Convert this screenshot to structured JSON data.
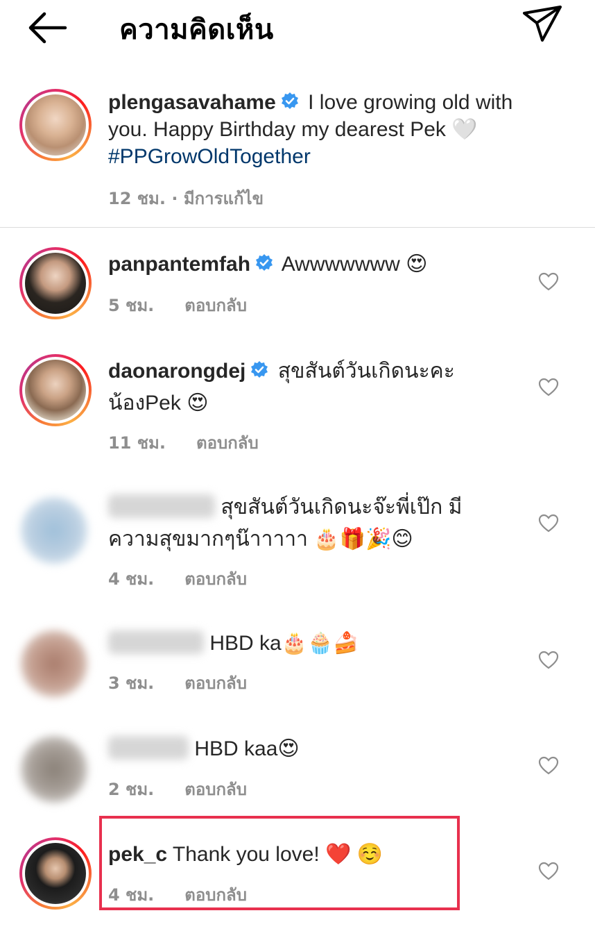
{
  "header": {
    "title": "ความคิดเห็น",
    "back_icon": "arrow-left-icon",
    "send_icon": "paper-plane-icon"
  },
  "caption": {
    "username": "plengasavahame",
    "text": "I love growing old with you. Happy Birthday my dearest Pek 🤍",
    "hashtag": "#PPGrowOldTogether",
    "time": "12 ชม.",
    "edited": "· มีการแก้ไข"
  },
  "comments": [
    {
      "username": "panpantemfah",
      "text": "Awwwwwww 😍",
      "time": "5 ชม.",
      "reply": "ตอบกลับ"
    },
    {
      "username": "daonarongdej",
      "text": "สุขสันต์วันเกิดนะคะ น้องPek 😍",
      "time": "11 ชม.",
      "reply": "ตอบกลับ"
    },
    {
      "username": "",
      "text": "สุขสันต์วันเกิดนะจ๊ะพี่เป๊ก มีความสุขมากๆน๊าาาาา 🎂🎁🎉😊",
      "time": "4 ชม.",
      "reply": "ตอบกลับ"
    },
    {
      "username": "",
      "text": "HBD ka🎂🧁🍰",
      "time": "3 ชม.",
      "reply": "ตอบกลับ"
    },
    {
      "username": "",
      "text": "HBD kaa😍",
      "time": "2 ชม.",
      "reply": "ตอบกลับ"
    },
    {
      "username": "pek_c",
      "text": "Thank you love! ❤️ ☺️",
      "time": "4 ชม.",
      "reply": "ตอบกลับ"
    }
  ],
  "colors": {
    "highlight": "#e8304e",
    "verified": "#3897f0",
    "hashtag": "#00376b"
  }
}
